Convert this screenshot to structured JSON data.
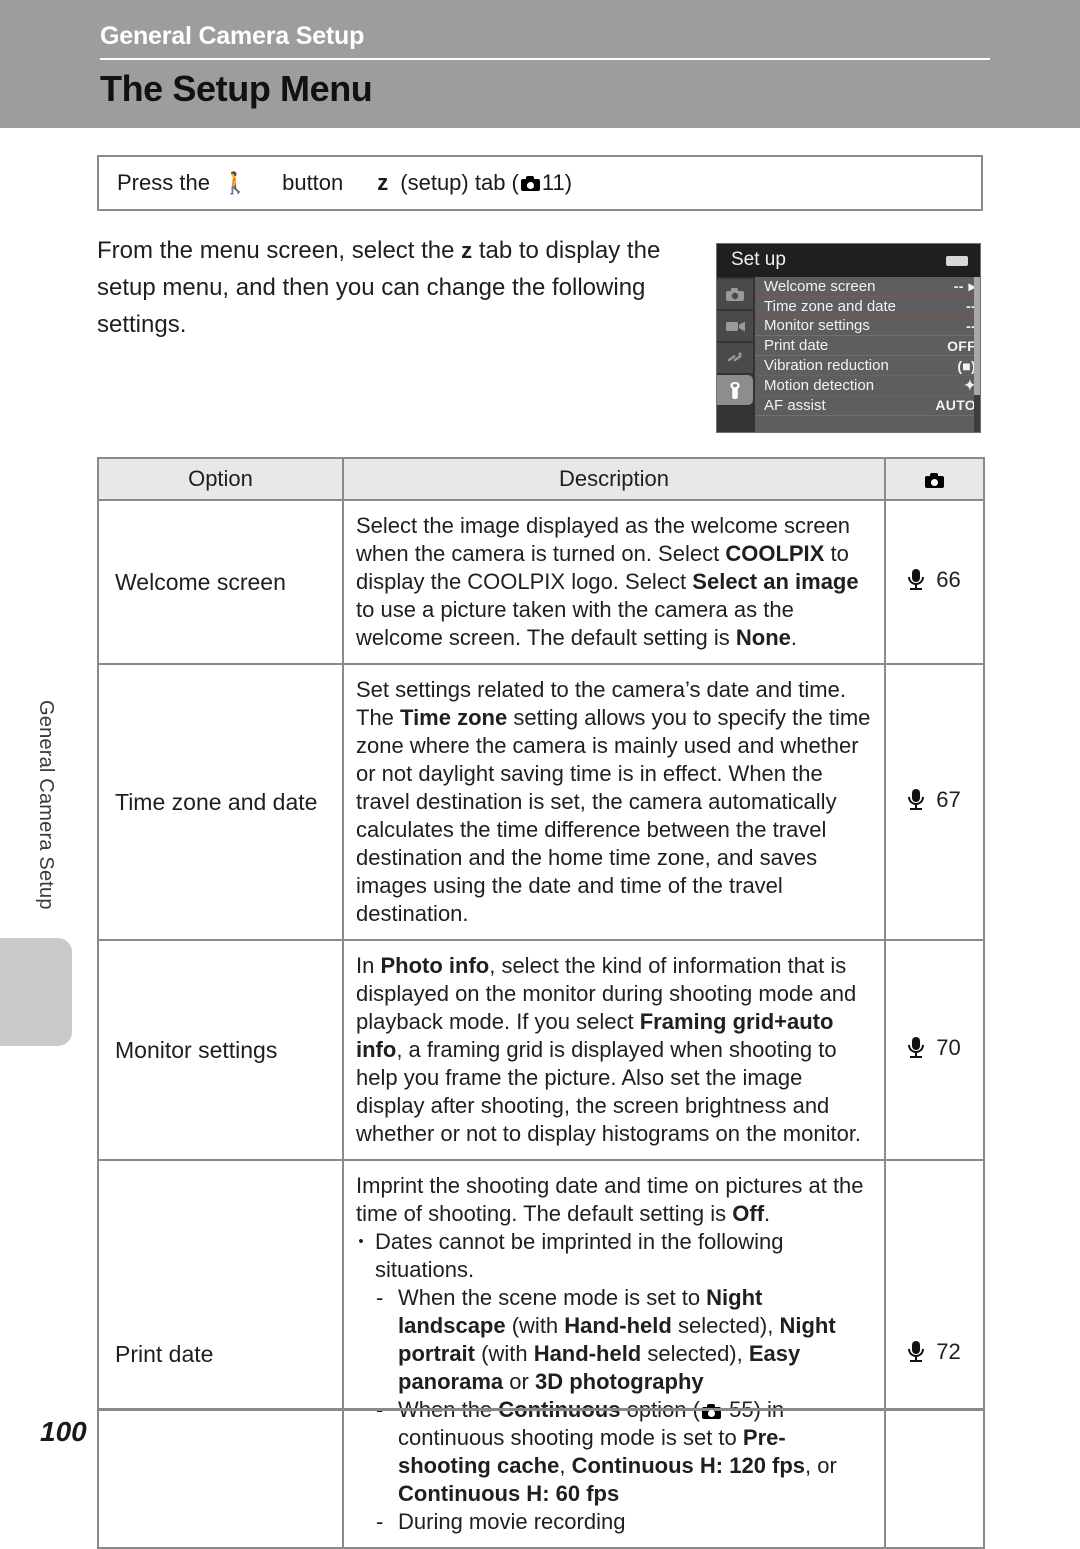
{
  "header": {
    "chapter_title": "General Camera Setup",
    "section_title": "The Setup Menu"
  },
  "side_tab": {
    "label": "General Camera Setup"
  },
  "press_box": {
    "press_the": "Press the",
    "menu_icon": "menu-button-icon",
    "button_word": "button",
    "setup_tab_glyph": "z",
    "setup_tab_text": "(setup) tab (",
    "camera_icon": "camera-ref-icon",
    "page_ref": "11",
    "close_paren": ")"
  },
  "intro": {
    "part1": "From the menu screen, select the ",
    "tab_glyph": "z",
    "part2": " tab to display the setup menu, and then you can change the following settings."
  },
  "camera_screen": {
    "title": "Set up",
    "battery_icon": "battery-icon",
    "tabs": [
      {
        "name": "shooting-tab",
        "glyph": "■",
        "active": false
      },
      {
        "name": "movie-tab",
        "glyph": "■",
        "active": false
      },
      {
        "name": "effects-tab",
        "glyph": "■",
        "active": false
      },
      {
        "name": "setup-tab",
        "glyph": "⚒",
        "active": true
      }
    ],
    "menu_items": [
      {
        "label": "Welcome screen",
        "value": "--",
        "arrow": true
      },
      {
        "label": "Time zone and date",
        "value": "--",
        "arrow": false
      },
      {
        "label": "Monitor settings",
        "value": "--",
        "arrow": false
      },
      {
        "label": "Print date",
        "value": "OFF",
        "arrow": false
      },
      {
        "label": "Vibration reduction",
        "value": "(■)",
        "arrow": false
      },
      {
        "label": "Motion detection",
        "value": "✦",
        "arrow": false
      },
      {
        "label": "AF assist",
        "value": "AUTO",
        "arrow": false
      }
    ]
  },
  "table": {
    "headers": {
      "option": "Option",
      "description": "Description",
      "reference": "camera-ref-icon"
    },
    "rows": [
      {
        "option": "Welcome screen",
        "ref_page": "66",
        "description_runs": [
          {
            "t": "Select the image displayed as the welcome screen when the camera is turned on. Select ",
            "b": false
          },
          {
            "t": "COOLPIX",
            "b": true
          },
          {
            "t": " to display the COOLPIX logo. Select ",
            "b": false
          },
          {
            "t": "Select an image",
            "b": true
          },
          {
            "t": " to use a picture taken with the camera as the welcome screen. The default setting is ",
            "b": false
          },
          {
            "t": "None",
            "b": true
          },
          {
            "t": ".",
            "b": false
          }
        ]
      },
      {
        "option": "Time zone and date",
        "ref_page": "67",
        "description_runs": [
          {
            "t": "Set settings related to the camera’s date and time. The ",
            "b": false
          },
          {
            "t": "Time zone",
            "b": true
          },
          {
            "t": " setting allows you to specify the time zone where the camera is mainly used and whether or not daylight saving time is in effect. When the    travel destination is set, the camera automatically calculates the time difference between the travel destination and the    home time zone, and saves images using the date and time of the travel destination.",
            "b": false
          }
        ]
      },
      {
        "option": "Monitor settings",
        "ref_page": "70",
        "description_runs": [
          {
            "t": "In ",
            "b": false
          },
          {
            "t": "Photo info",
            "b": true
          },
          {
            "t": ", select the kind of information that is displayed on the monitor during shooting mode and playback mode. If you select ",
            "b": false
          },
          {
            "t": "Framing grid+auto info",
            "b": true
          },
          {
            "t": ", a framing grid is displayed when shooting to help you frame the picture. Also set the image display after shooting, the screen brightness and whether or not to display histograms on the monitor.",
            "b": false
          }
        ]
      },
      {
        "option": "Print date",
        "ref_page": "72",
        "print_date": {
          "intro_runs": [
            {
              "t": "Imprint the shooting date and time on pictures at the time of shooting. The default setting is ",
              "b": false
            },
            {
              "t": "Off",
              "b": true
            },
            {
              "t": ".",
              "b": false
            }
          ],
          "bullet_mark": "•",
          "bullet_text": "Dates cannot be imprinted in the following situations.",
          "dash_mark": "-",
          "dash_items": [
            {
              "runs": [
                {
                  "t": "When the scene mode is set to ",
                  "b": false
                },
                {
                  "t": "Night landscape",
                  "b": true
                },
                {
                  "t": " (with ",
                  "b": false
                },
                {
                  "t": "Hand-held",
                  "b": true
                },
                {
                  "t": " selected), ",
                  "b": false
                },
                {
                  "t": "Night portrait",
                  "b": true
                },
                {
                  "t": " (with ",
                  "b": false
                },
                {
                  "t": "Hand-held",
                  "b": true
                },
                {
                  "t": " selected), ",
                  "b": false
                },
                {
                  "t": "Easy panorama",
                  "b": true
                },
                {
                  "t": " or ",
                  "b": false
                },
                {
                  "t": "3D photography",
                  "b": true
                }
              ]
            },
            {
              "runs": [
                {
                  "t": "When the ",
                  "b": false
                },
                {
                  "t": "Continuous",
                  "b": true
                },
                {
                  "t": " option (",
                  "b": false
                },
                {
                  "t": "__CAMICON__",
                  "b": false
                },
                {
                  "t": " 55) in continuous shooting mode is set to ",
                  "b": false
                },
                {
                  "t": "Pre-shooting cache",
                  "b": true
                },
                {
                  "t": ", ",
                  "b": false
                },
                {
                  "t": "Continuous H: 120 fps",
                  "b": true
                },
                {
                  "t": ", or ",
                  "b": false
                },
                {
                  "t": "Continuous H: 60 fps",
                  "b": true
                }
              ]
            },
            {
              "runs": [
                {
                  "t": "During movie recording",
                  "b": false
                }
              ]
            }
          ]
        }
      }
    ]
  },
  "footer": {
    "page_number": "100"
  }
}
